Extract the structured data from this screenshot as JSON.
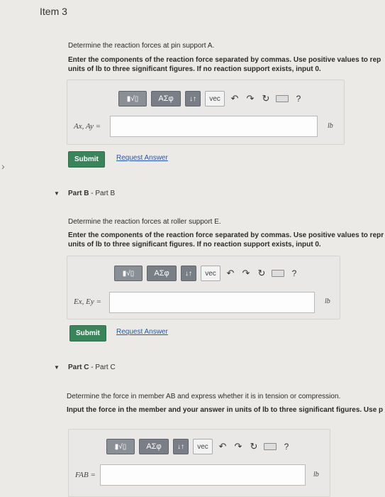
{
  "item_title": "Item 3",
  "part_a": {
    "prompt": "Determine the reaction forces at pin support A.",
    "instructions_line1": "Enter the components of the reaction force separated by commas. Use positive values to rep",
    "instructions_line2": "units of lb to three significant figures. If no reaction support exists, input 0.",
    "answer_label": "Ax, Ay =",
    "unit": "lb",
    "submit_label": "Submit",
    "request_label": "Request Answer"
  },
  "part_b": {
    "header_bold": "Part B",
    "header_rest": " - Part B",
    "prompt": "Determine the reaction forces at roller support E.",
    "instructions_line1": "Enter the components of the reaction force separated by commas. Use positive values to repr",
    "instructions_line2": "units of lb to three significant figures. If no reaction support exists, input 0.",
    "answer_label": "Ex, Ey =",
    "unit": "lb",
    "submit_label": "Submit",
    "request_label": "Request Answer"
  },
  "part_c": {
    "header_bold": "Part C",
    "header_rest": " - Part C",
    "prompt": "Determine the force in member AB and express whether it is in tension or compression.",
    "instructions_line1": "Input the force in the member and your answer in units of lb to three significant figures. Use p",
    "answer_label": "FAB =",
    "unit": "lb"
  },
  "toolbar": {
    "sqrt_label": "▮√▯",
    "greek_label": "ΑΣφ",
    "arrows_label": "↓↑",
    "vec_label": "vec",
    "help_label": "?"
  }
}
